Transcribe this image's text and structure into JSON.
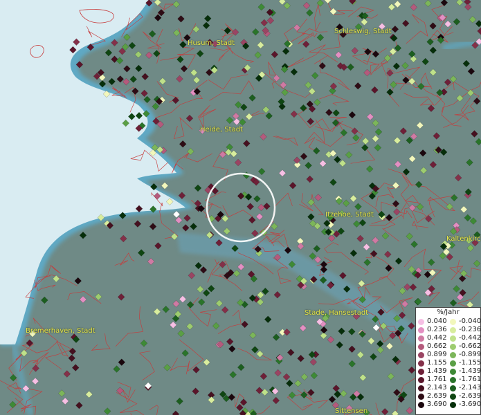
{
  "cities": [
    {
      "name": "Husum, Stadt",
      "id": "husum"
    },
    {
      "name": "Schleswig, Stadt",
      "id": "schleswig"
    },
    {
      "name": "Heide, Stadt",
      "id": "heide"
    },
    {
      "name": "Itzehoe, Stadt",
      "id": "itzehoe"
    },
    {
      "name": "Kaltenkirch",
      "id": "kaltenkirchen"
    },
    {
      "name": "Stade, Hansestadt",
      "id": "stade"
    },
    {
      "name": "Bremerhaven, Stadt",
      "id": "bremerhaven"
    },
    {
      "name": "Sittensen",
      "id": "sittensen"
    }
  ],
  "legend": {
    "title": "%/Jahr",
    "positive": {
      "values": [
        "0.040",
        "0.236",
        "0.442",
        "0.662",
        "0.899",
        "1.155",
        "1.439",
        "1.761",
        "2.143",
        "2.639",
        "3.690"
      ],
      "colors": [
        "#f6bfe4",
        "#e38fc2",
        "#cf7aa3",
        "#b45a7c",
        "#9a4563",
        "#843049",
        "#6e2038",
        "#5a152a",
        "#45101f",
        "#2e0c15",
        "#1a070d"
      ]
    },
    "negative": {
      "values": [
        "-0.040",
        "-0.236",
        "-0.442",
        "-0.662",
        "-0.899",
        "-1.155",
        "-1.439",
        "-1.761",
        "-2.143",
        "-2.639",
        "-3.690"
      ],
      "colors": [
        "#f2f7bc",
        "#d8ed9e",
        "#bfe18a",
        "#9dcc6f",
        "#7cb65a",
        "#5a9f45",
        "#3e8a36",
        "#2a742a",
        "#1c5e1f",
        "#0f4612",
        "#062e0a"
      ]
    }
  },
  "colors": {
    "sea": "#d9ecf2",
    "coast": "#5fa9c4",
    "land": "#6f8a86",
    "borders": "#c73a3a",
    "city_labels": "#e6e64a",
    "selection_circle": "#ffffff"
  }
}
